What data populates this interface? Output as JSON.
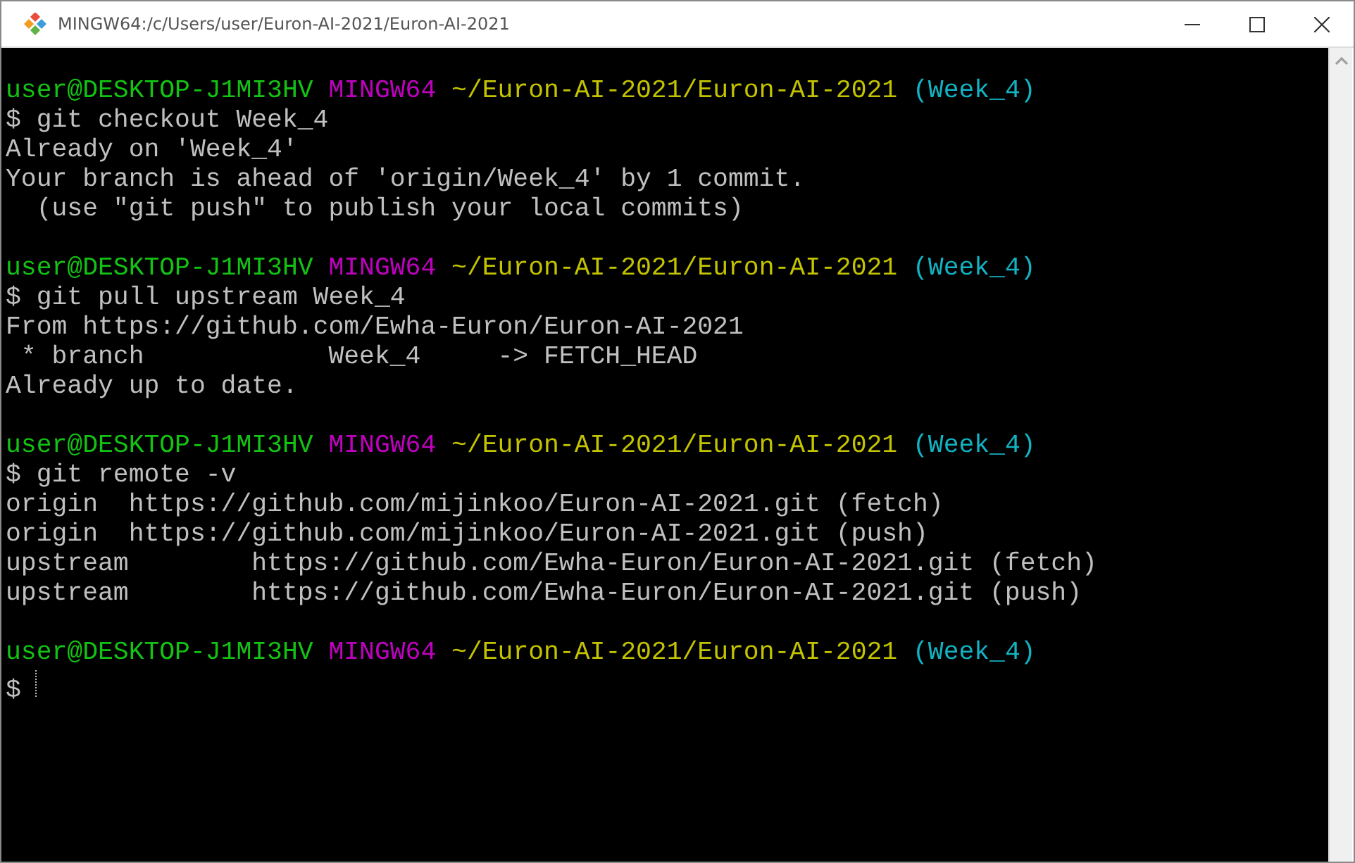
{
  "window": {
    "title": "MINGW64:/c/Users/user/Euron-AI-2021/Euron-AI-2021"
  },
  "lines": [
    {
      "kind": "blank"
    },
    {
      "kind": "prompt",
      "user": "user@DESKTOP-J1MI3HV",
      "shell": "MINGW64",
      "path": "~/Euron-AI-2021/Euron-AI-2021",
      "branch": "(Week_4)"
    },
    {
      "kind": "input",
      "text": "$ git checkout Week_4",
      "cursor": false
    },
    {
      "kind": "output",
      "text": "Already on 'Week_4'"
    },
    {
      "kind": "output",
      "text": "Your branch is ahead of 'origin/Week_4' by 1 commit."
    },
    {
      "kind": "output",
      "text": "  (use \"git push\" to publish your local commits)"
    },
    {
      "kind": "blank"
    },
    {
      "kind": "prompt",
      "user": "user@DESKTOP-J1MI3HV",
      "shell": "MINGW64",
      "path": "~/Euron-AI-2021/Euron-AI-2021",
      "branch": "(Week_4)"
    },
    {
      "kind": "input",
      "text": "$ git pull upstream Week_4",
      "cursor": false
    },
    {
      "kind": "output",
      "text": "From https://github.com/Ewha-Euron/Euron-AI-2021"
    },
    {
      "kind": "output",
      "text": " * branch            Week_4     -> FETCH_HEAD"
    },
    {
      "kind": "output",
      "text": "Already up to date."
    },
    {
      "kind": "blank"
    },
    {
      "kind": "prompt",
      "user": "user@DESKTOP-J1MI3HV",
      "shell": "MINGW64",
      "path": "~/Euron-AI-2021/Euron-AI-2021",
      "branch": "(Week_4)"
    },
    {
      "kind": "input",
      "text": "$ git remote -v",
      "cursor": false
    },
    {
      "kind": "output",
      "text": "origin  https://github.com/mijinkoo/Euron-AI-2021.git (fetch)"
    },
    {
      "kind": "output",
      "text": "origin  https://github.com/mijinkoo/Euron-AI-2021.git (push)"
    },
    {
      "kind": "output",
      "text": "upstream        https://github.com/Ewha-Euron/Euron-AI-2021.git (fetch)"
    },
    {
      "kind": "output",
      "text": "upstream        https://github.com/Ewha-Euron/Euron-AI-2021.git (push)"
    },
    {
      "kind": "blank"
    },
    {
      "kind": "prompt",
      "user": "user@DESKTOP-J1MI3HV",
      "shell": "MINGW64",
      "path": "~/Euron-AI-2021/Euron-AI-2021",
      "branch": "(Week_4)"
    },
    {
      "kind": "input",
      "text": "$",
      "cursor": true
    }
  ]
}
